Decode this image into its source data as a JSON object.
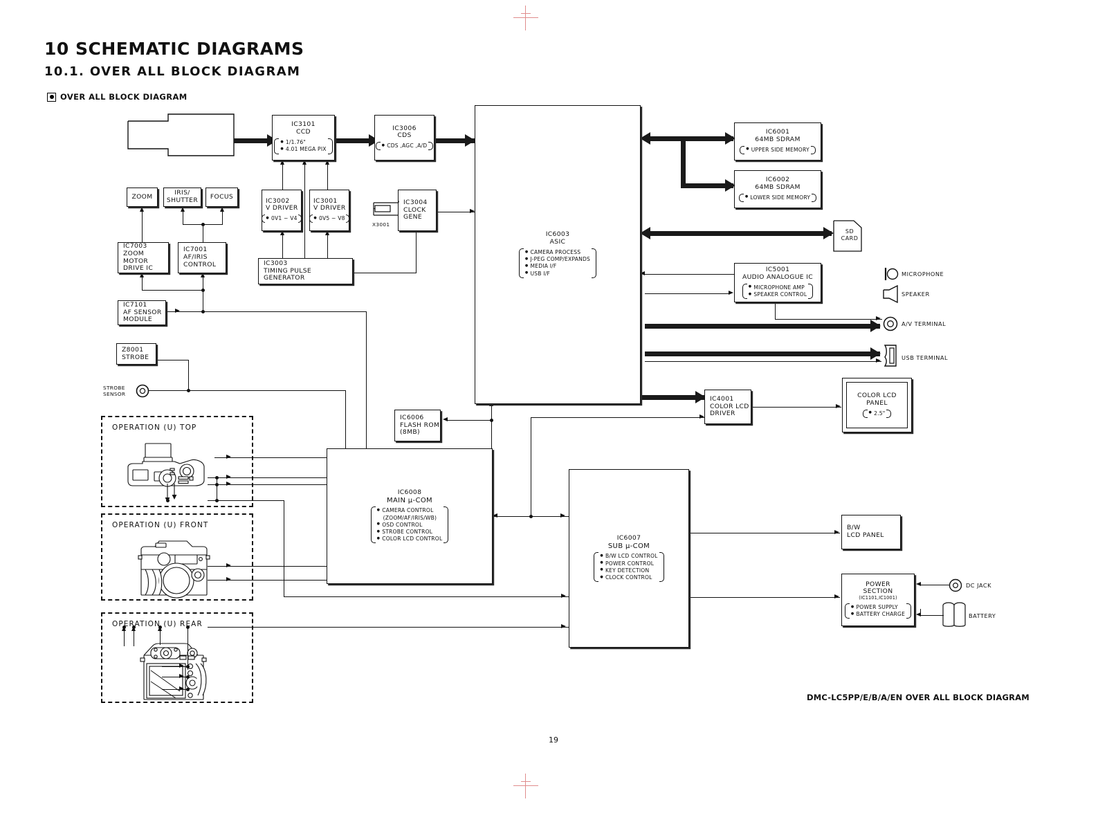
{
  "document": {
    "heading_number": "10",
    "heading_title": "SCHEMATIC DIAGRAMS",
    "subheading": "10.1.   OVER ALL BLOCK DIAGRAM",
    "section_label": "OVER ALL BLOCK DIAGRAM",
    "footer": "DMC-LC5PP/E/B/A/EN OVER ALL BLOCK DIAGRAM",
    "page_number": "19"
  },
  "blocks": {
    "ccd": {
      "id": "IC3101",
      "name": "CCD",
      "bullets": [
        "1/1.76\"",
        "4.01 MEGA PIX"
      ]
    },
    "cds": {
      "id": "IC3006",
      "name": "CDS",
      "bullets": [
        "CDS ,AGC ,A/D"
      ]
    },
    "asic": {
      "id": "IC6003",
      "name": "ASIC",
      "bullets": [
        "CAMERA PROCESS",
        "J-PEG COMP/EXPANDS",
        "MEDIA I/F",
        "USB I/F"
      ]
    },
    "sdram_upper": {
      "id": "IC6001",
      "name": "64MB SDRAM",
      "bullets": [
        "UPPER SIDE MEMORY"
      ]
    },
    "sdram_lower": {
      "id": "IC6002",
      "name": "64MB SDRAM",
      "bullets": [
        "LOWER SIDE MEMORY"
      ]
    },
    "audio": {
      "id": "IC5001",
      "name": "AUDIO ANALOGUE IC",
      "bullets": [
        "MICROPHONE AMP",
        "SPEAKER CONTROL"
      ]
    },
    "vdriver_a": {
      "id": "IC3002",
      "name": "V DRIVER",
      "bullets": [
        "0V1 ~ V4"
      ]
    },
    "vdriver_b": {
      "id": "IC3001",
      "name": "V DRIVER",
      "bullets": [
        "0V5 ~ V8"
      ]
    },
    "clock": {
      "id": "IC3004",
      "name": "CLOCK\nGENE",
      "bullets": []
    },
    "tpg": {
      "id": "IC3003",
      "name": "TIMING PULSE GENERATOR",
      "bullets": []
    },
    "zoom_motor": {
      "id": "IC7003",
      "name": "ZOOM MOTOR\nDRIVE IC",
      "bullets": []
    },
    "af_iris": {
      "id": "IC7001",
      "name": "AF/IRIS\nCONTROL",
      "bullets": []
    },
    "af_sensor": {
      "id": "IC7101",
      "name": "AF SENSOR\nMODULE",
      "bullets": []
    },
    "strobe": {
      "id": "Z8001",
      "name": "STROBE",
      "bullets": []
    },
    "flash_rom": {
      "id": "IC6006",
      "name": "FLASH ROM\n(8MB)",
      "bullets": []
    },
    "main_ucom": {
      "id": "IC6008",
      "name": "MAIN μ-COM",
      "bullets": [
        "CAMERA CONTROL",
        "(ZOOM/AF/IRIS/WB)",
        "OSD CONTROL",
        "STROBE CONTROL",
        "COLOR LCD CONTROL"
      ]
    },
    "sub_ucom": {
      "id": "IC6007",
      "name": "SUB μ-COM",
      "bullets": [
        "B/W LCD CONTROL",
        "POWER CONTROL",
        "KEY DETECTION",
        "CLOCK CONTROL"
      ]
    },
    "lcd_driver": {
      "id": "IC4001",
      "name": "COLOR LCD\nDRIVER",
      "bullets": []
    },
    "color_lcd_panel": {
      "id": "",
      "name": "COLOR LCD\nPANEL",
      "bullets": [
        "2.5\""
      ]
    },
    "bw_lcd_panel": {
      "id": "",
      "name": "B/W\nLCD PANEL",
      "bullets": []
    },
    "power_section": {
      "id": "",
      "name": "POWER\nSECTION",
      "sub": "(IC1101,IC1001)",
      "bullets": [
        "POWER SUPPLY",
        "BATTERY CHARGE"
      ]
    }
  },
  "lens_blocks": {
    "zoom": "ZOOM",
    "iris_shutter": "IRIS/\nSHUTTER",
    "focus": "FOCUS"
  },
  "labels": {
    "crystal": "X3001",
    "strobe_sensor": "STROBE\nSENSOR",
    "sd_card": "SD\nCARD",
    "microphone": "MICROPHONE",
    "speaker": "SPEAKER",
    "av_terminal": "A/V TERMINAL",
    "usb_terminal": "USB TERMINAL",
    "dc_jack": "DC JACK",
    "battery": "BATTERY"
  },
  "operation_groups": [
    {
      "label": "OPERATION (U) TOP"
    },
    {
      "label": "OPERATION (U) FRONT"
    },
    {
      "label": "OPERATION (U) REAR"
    }
  ],
  "colors": {
    "ink": "#111111",
    "paper": "#ffffff",
    "crop_mark": "#e08c8c"
  }
}
